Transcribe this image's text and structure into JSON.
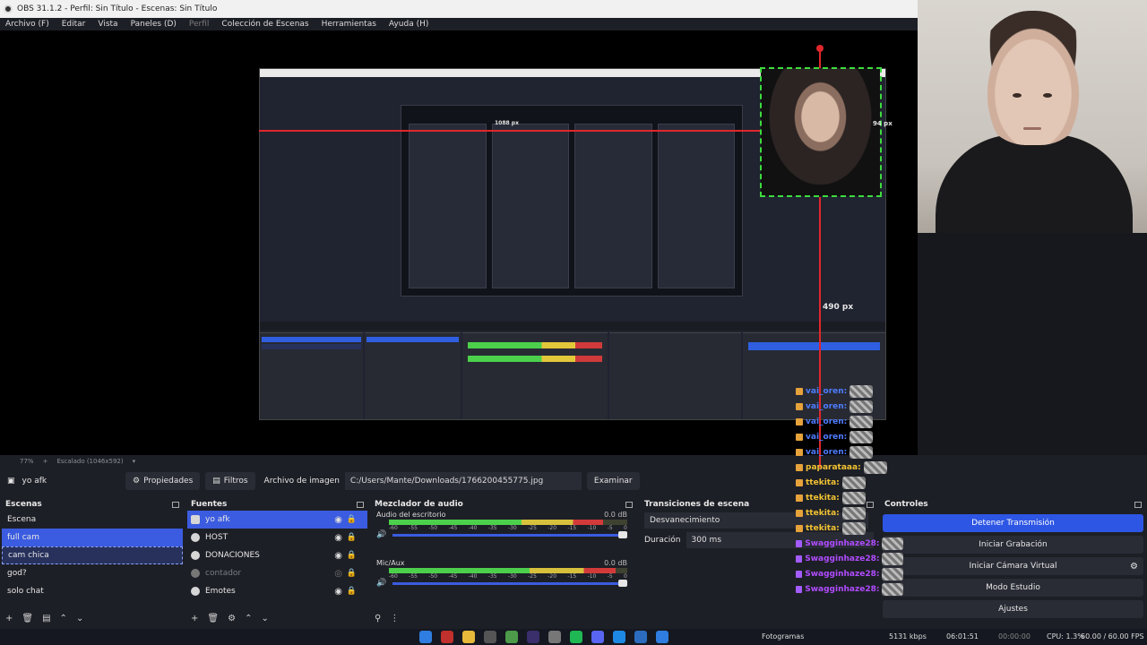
{
  "window": {
    "title": "OBS 31.1.2 - Perfil: Sin Título - Escenas: Sin Título"
  },
  "menu": {
    "items": [
      "Archivo (F)",
      "Editar",
      "Vista",
      "Paneles (D)",
      "Perfil",
      "Colección de Escenas",
      "Herramientas",
      "Ayuda (H)"
    ]
  },
  "preview": {
    "width_label": "1088 px",
    "height_label": "490 px",
    "offset_label": "94 px",
    "zoom_label": "77%",
    "scale_label": "Escalado (1046x592)"
  },
  "source_toolbar": {
    "selected_source": "yo afk",
    "properties_label": "Propiedades",
    "filters_label": "Filtros",
    "image_file_label": "Archivo de imagen",
    "path_value": "C:/Users/Mante/Downloads/1766200455775.jpg",
    "browse_label": "Examinar"
  },
  "scenes": {
    "title": "Escenas",
    "items": [
      "Escena",
      "full cam",
      "cam chica",
      "god?",
      "solo chat"
    ]
  },
  "sources": {
    "title": "Fuentes",
    "items": [
      "yo afk",
      "HOST",
      "DONACIONES",
      "contador",
      "Emotes"
    ]
  },
  "mixer": {
    "title": "Mezclador de audio",
    "channels": [
      {
        "name": "Audio del escritorio",
        "db": "0.0 dB",
        "level": 0.9
      },
      {
        "name": "Mic/Aux",
        "db": "0.0 dB",
        "level": 0.95
      }
    ],
    "ticks": [
      "-60",
      "-55",
      "-50",
      "-45",
      "-40",
      "-35",
      "-30",
      "-25",
      "-20",
      "-15",
      "-10",
      "-5",
      "0"
    ]
  },
  "transitions": {
    "title": "Transiciones de escena",
    "type": "Desvanecimiento",
    "duration_label": "Duración",
    "duration_value": "300 ms"
  },
  "controls": {
    "title": "Controles",
    "stop_stream": "Detener Transmisión",
    "start_record": "Iniciar Grabación",
    "virtual_cam": "Iniciar Cámara Virtual",
    "studio_mode": "Modo Estudio",
    "settings": "Ajustes"
  },
  "chat": {
    "lines": [
      {
        "user": "vai_oren:",
        "color": "#4e7cff"
      },
      {
        "user": "vai_oren:",
        "color": "#4e7cff"
      },
      {
        "user": "vai_oren:",
        "color": "#4e7cff"
      },
      {
        "user": "vai_oren:",
        "color": "#4e7cff"
      },
      {
        "user": "vai_oren:",
        "color": "#4e7cff"
      },
      {
        "user": "paparataaa:",
        "color": "#f1c232"
      },
      {
        "user": "ttekita:",
        "color": "#f1c232"
      },
      {
        "user": "ttekita:",
        "color": "#f1c232"
      },
      {
        "user": "ttekita:",
        "color": "#f1c232"
      },
      {
        "user": "ttekita:",
        "color": "#f1c232"
      },
      {
        "user": "Swagginhaze28:",
        "color": "#b04cff"
      },
      {
        "user": "Swagginhaze28:",
        "color": "#b04cff"
      },
      {
        "user": "Swagginhaze28:",
        "color": "#b04cff"
      },
      {
        "user": "Swagginhaze28:",
        "color": "#b04cff"
      }
    ]
  },
  "statusbar": {
    "frames_label": "Fotogramas",
    "kbps": "5131 kbps",
    "time": "06:01:51",
    "rec_time": "00:00:00",
    "cpu": "CPU: 1.3%",
    "fps": "60.00 / 60.00 FPS"
  },
  "colors": {
    "accent": "#3b5ce0",
    "selection_green": "#3ddc3d",
    "guide_red": "#e0272b"
  }
}
